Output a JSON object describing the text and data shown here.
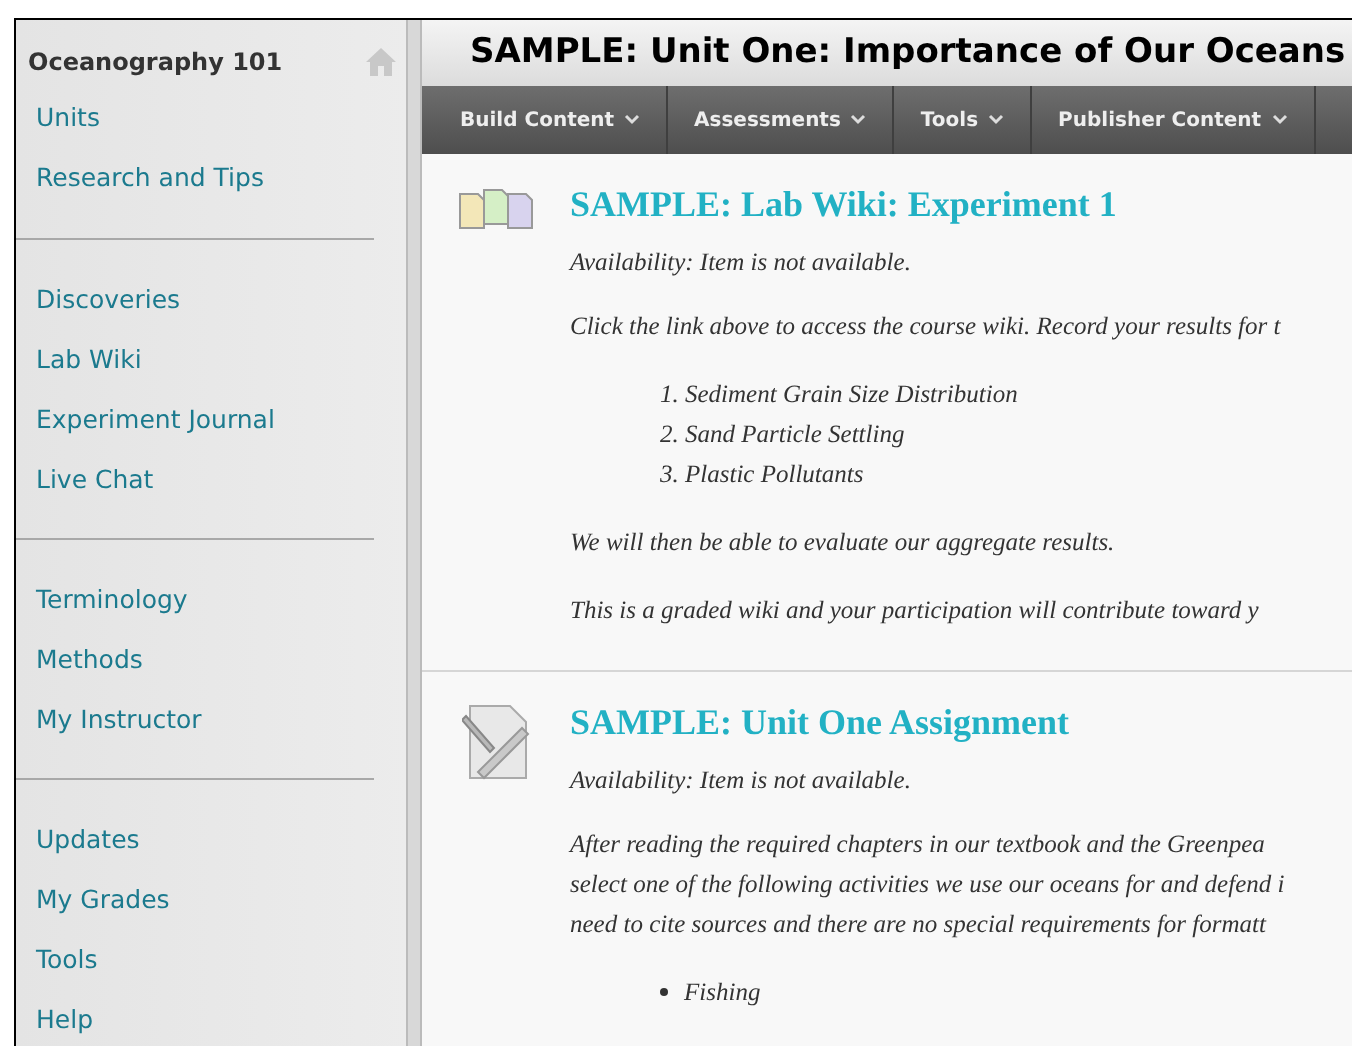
{
  "sidebar": {
    "course_title": "Oceanography 101",
    "groups": [
      {
        "items": [
          "Units",
          "Research and Tips"
        ]
      },
      {
        "items": [
          "Discoveries",
          "Lab Wiki",
          "Experiment Journal",
          "Live Chat"
        ]
      },
      {
        "items": [
          "Terminology",
          "Methods",
          "My Instructor"
        ]
      },
      {
        "items": [
          "Updates",
          "My Grades",
          "Tools",
          "Help"
        ]
      }
    ]
  },
  "page_title": "SAMPLE: Unit One: Importance of Our Oceans",
  "toolbar": [
    "Build Content",
    "Assessments",
    "Tools",
    "Publisher Content"
  ],
  "content_items": [
    {
      "kind": "wiki",
      "title": "SAMPLE: Lab Wiki: Experiment 1",
      "availability": "Availability:  Item is not available.",
      "blocks": [
        {
          "kind": "paragraph",
          "lines": [
            "Click the link above to access the course wiki. Record your results for t"
          ]
        },
        {
          "kind": "ordered",
          "items": [
            "1. Sediment Grain Size Distribution",
            "2. Sand Particle Settling",
            "3. Plastic Pollutants"
          ]
        },
        {
          "kind": "paragraph",
          "lines": [
            "We will then be able to evaluate our aggregate results."
          ]
        },
        {
          "kind": "paragraph",
          "lines": [
            "This is a graded wiki and your participation will contribute toward y"
          ]
        }
      ]
    },
    {
      "kind": "assignment",
      "title": "SAMPLE: Unit One Assignment",
      "availability": "Availability:  Item is not available.",
      "blocks": [
        {
          "kind": "paragraph",
          "lines": [
            "After reading the required chapters in our textbook and the Greenpea",
            "select one of the following activities we use our oceans for and defend i",
            "need to cite sources and there are no special requirements for formatt"
          ]
        },
        {
          "kind": "bullets",
          "items": [
            "Fishing"
          ]
        }
      ]
    }
  ]
}
